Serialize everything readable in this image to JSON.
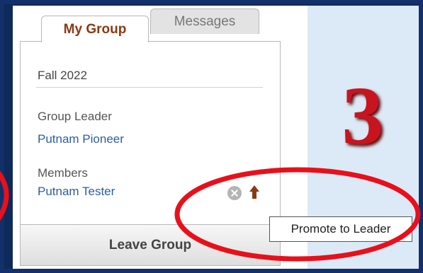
{
  "tabs": [
    {
      "label": "My Group",
      "active": true
    },
    {
      "label": "Messages",
      "active": false
    }
  ],
  "group": {
    "term": "Fall 2022",
    "leader_label": "Group Leader",
    "leader_name": "Putnam Pioneer",
    "members_label": "Members",
    "members": [
      {
        "name": "Putnam Tester",
        "actions": [
          "remove-icon",
          "promote-icon"
        ]
      }
    ]
  },
  "leave_button": "Leave Group",
  "tooltip": "Promote to Leader",
  "step_number": "3",
  "colors": {
    "active_tab_text": "#8a3a12",
    "link": "#2c5ea0",
    "annotation": "#e8101a",
    "step_number": "#c8141e",
    "info_panel": "#dce9f6"
  }
}
